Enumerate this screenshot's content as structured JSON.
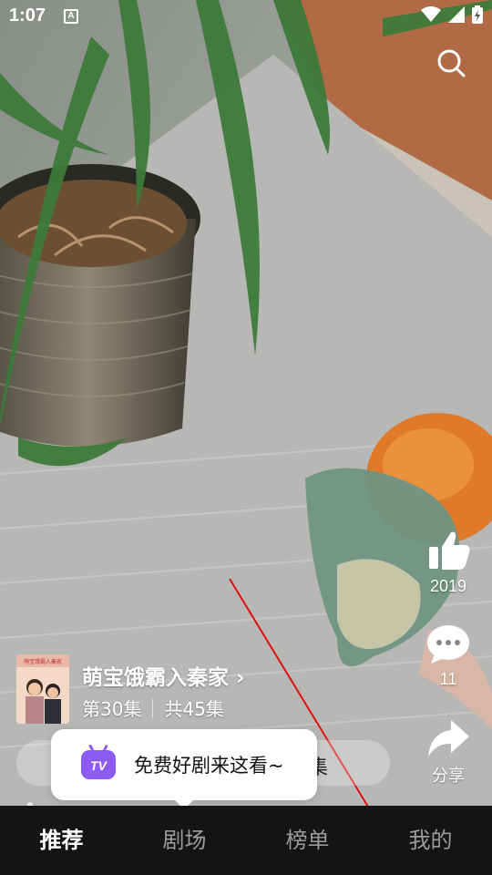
{
  "status_bar": {
    "time": "1:07",
    "notification_icon": "A"
  },
  "right_rail": {
    "like_count": "2019",
    "comment_count": "11",
    "share_label": "分享"
  },
  "drama": {
    "title": "萌宝饿霸入秦家",
    "title_chevron": "›",
    "episode": "第30集",
    "total": "共45集",
    "poster_caption": "萌宝饿霸入秦家"
  },
  "episode_bar": {
    "visible_text": "集"
  },
  "toast": {
    "icon_text": "TV",
    "message": "免费好剧来这看~"
  },
  "bottom_nav": {
    "items": [
      "推荐",
      "剧场",
      "榜单",
      "我的"
    ],
    "active_index": 0
  },
  "colors": {
    "nav_bg": "#141414",
    "toast_icon": "#8b5cf6",
    "annotation_arrow": "#e01010"
  },
  "icons": [
    "search-icon",
    "wifi-icon",
    "signal-icon",
    "battery-icon",
    "thumbs-up-icon",
    "comment-icon",
    "share-icon",
    "tv-icon"
  ]
}
